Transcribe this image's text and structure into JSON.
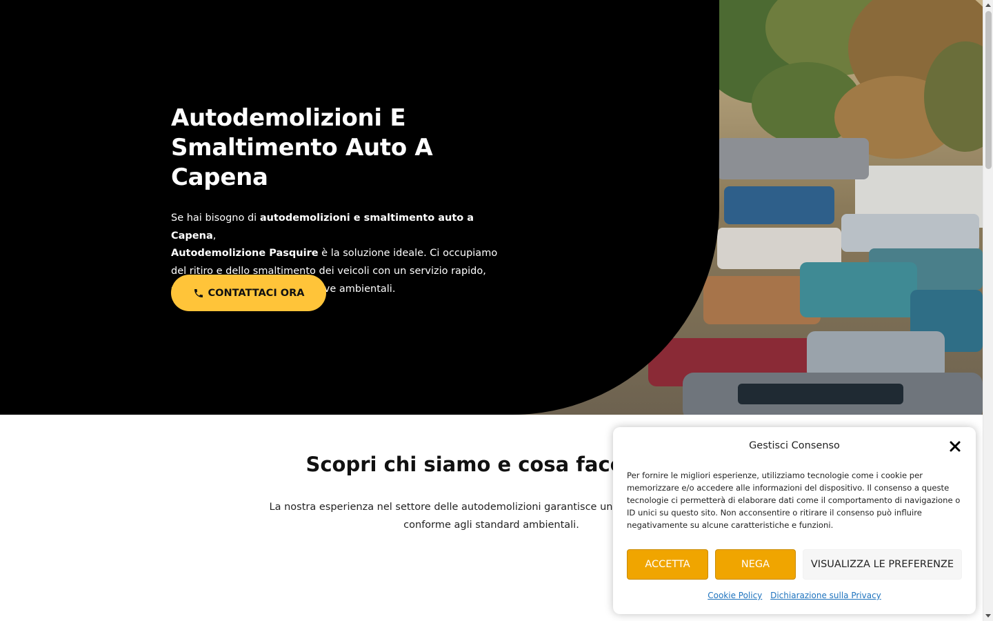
{
  "hero": {
    "title_line1": "Autodemolizioni E",
    "title_line2": "Smaltimento Auto A Capena",
    "text_part1": "Se hai bisogno di ",
    "text_bold1": "autodemolizioni e smaltimento auto a Capena",
    "text_part2": ",",
    "text_bold2": "Autodemolizione Pasquire",
    "text_part3": " è la soluzione ideale. Ci occupiamo del ritiro e dello smaltimento dei veicoli con un servizio rapido, sicuro e conforme alle normative ambientali.",
    "cta_label": "CONTATTACI ORA",
    "cta_icon": "phone-icon",
    "image_alt": "junkyard-cars-image"
  },
  "about": {
    "title": "Scopri chi siamo e cosa facciamo",
    "text": "La nostra esperienza nel settore delle autodemolizioni garantisce un servizio efficiente e conforme agli standard ambientali."
  },
  "consent": {
    "title": "Gestisci Consenso",
    "body": "Per fornire le migliori esperienze, utilizziamo tecnologie come i cookie per memorizzare e/o accedere alle informazioni del dispositivo. Il consenso a queste tecnologie ci permetterà di elaborare dati come il comportamento di navigazione o ID unici su questo sito. Non acconsentire o ritirare il consenso può influire negativamente su alcune caratteristiche e funzioni.",
    "accept_label": "ACCETTA",
    "deny_label": "NEGA",
    "prefs_label": "VISUALIZZA LE PREFERENZE",
    "cookie_policy_label": "Cookie Policy",
    "privacy_label": "Dichiarazione sulla Privacy"
  },
  "colors": {
    "accent": "#ffc439",
    "consent_button": "#f0a500",
    "hero_background": "#000000",
    "link": "#1e73be"
  }
}
